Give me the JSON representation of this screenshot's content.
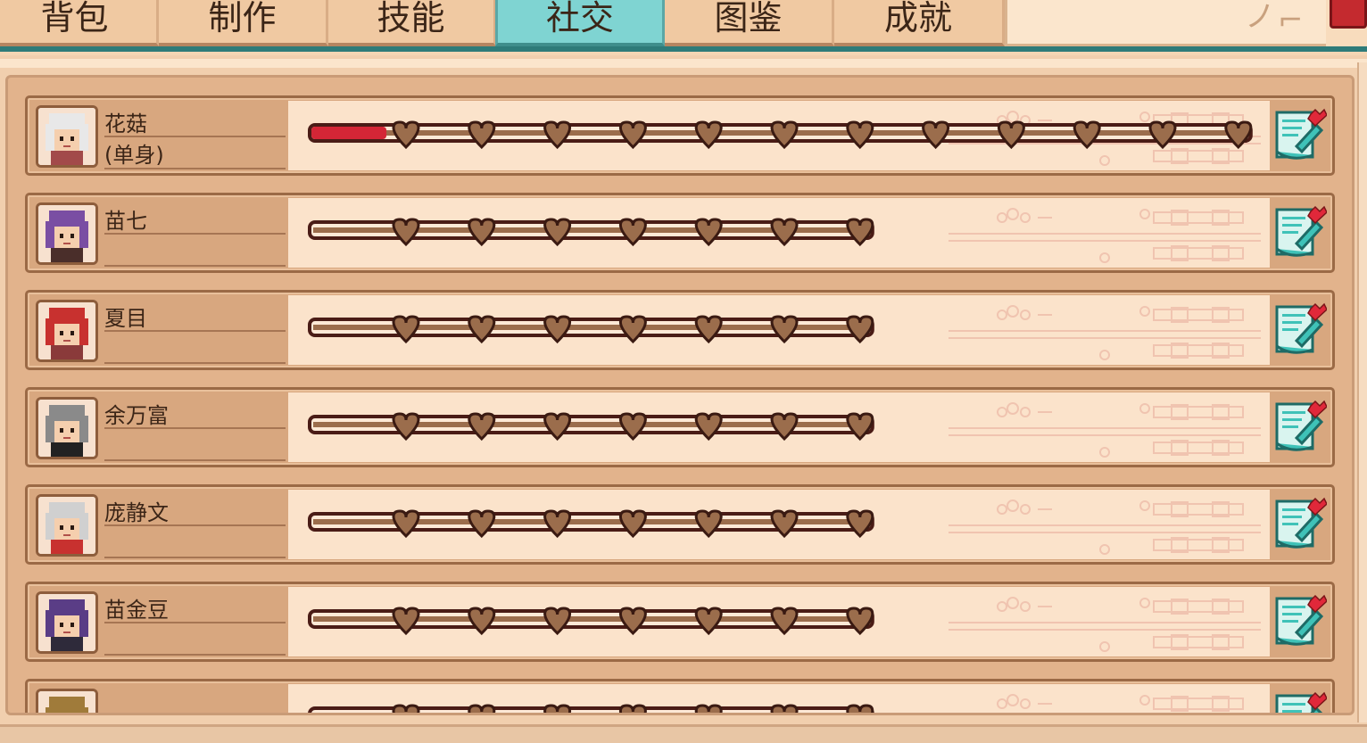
{
  "tabs": [
    {
      "label": "背包",
      "active": false
    },
    {
      "label": "制作",
      "active": false
    },
    {
      "label": "技能",
      "active": false
    },
    {
      "label": "社交",
      "active": true
    },
    {
      "label": "图鉴",
      "active": false
    },
    {
      "label": "成就",
      "active": false
    }
  ],
  "colors": {
    "active_tab": "#7fd4d2",
    "row_bg": "#d8a77f",
    "bar_bg": "#fbe3cb",
    "heart_fill": "#9b6d4c",
    "friendship_fill": "#d42636",
    "close_button": "#c42a2f",
    "letter_icon": "#3fc2b8"
  },
  "villagers": [
    {
      "name": "花菇",
      "status": "(单身)",
      "max_hearts": 12,
      "friendship": 0.08,
      "avatar_hair": "#e8e8e8",
      "avatar_accent": "#a24a4a",
      "avatar_icon": "silver-haired-girl-avatar"
    },
    {
      "name": "苗七",
      "status": "",
      "max_hearts": 7,
      "friendship": 0,
      "avatar_hair": "#7a4ea3",
      "avatar_accent": "#4a2e2a",
      "avatar_icon": "purple-haired-man-avatar"
    },
    {
      "name": "夏目",
      "status": "",
      "max_hearts": 7,
      "friendship": 0,
      "avatar_hair": "#c8312f",
      "avatar_accent": "#8a3a3a",
      "avatar_icon": "red-cap-girl-avatar"
    },
    {
      "name": "余万富",
      "status": "",
      "max_hearts": 7,
      "friendship": 0,
      "avatar_hair": "#8a8a8a",
      "avatar_accent": "#222222",
      "avatar_icon": "sunglasses-man-avatar"
    },
    {
      "name": "庞静文",
      "status": "",
      "max_hearts": 7,
      "friendship": 0,
      "avatar_hair": "#d0d0d0",
      "avatar_accent": "#c8312f",
      "avatar_icon": "grey-haired-woman-avatar"
    },
    {
      "name": "苗金豆",
      "status": "",
      "max_hearts": 7,
      "friendship": 0,
      "avatar_hair": "#5a3d86",
      "avatar_accent": "#2e2a3a",
      "avatar_icon": "boy-avatar"
    },
    {
      "name": "",
      "status": "",
      "max_hearts": 7,
      "friendship": 0,
      "avatar_hair": "#a07b3a",
      "avatar_accent": "#6a4a2a",
      "avatar_icon": "partial-avatar"
    }
  ]
}
